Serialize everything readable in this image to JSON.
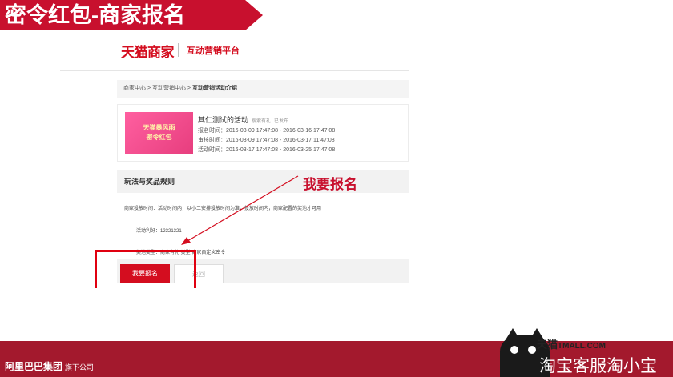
{
  "slide_title": "密令红包-商家报名",
  "header": {
    "brand": "天猫商家",
    "platform": "互动营销平台"
  },
  "breadcrumb": {
    "items": [
      "商家中心",
      "互动营销中心"
    ],
    "current": "互动营销活动介绍",
    "separator": " > "
  },
  "activity": {
    "thumb_line1": "天猫暴风雨",
    "thumb_line2": "密令红包",
    "title": "其仁测试的活动",
    "tag": "搜索有礼",
    "status": "已发布",
    "signup_time": "报名时间：2016-03-09 17:47:08 - 2016-03-16 17:47:08",
    "review_time": "审核时间：2016-03-09 17:47:08 - 2016-03-17 11:47:08",
    "event_time": "活动时间：2016-03-17 17:47:08 - 2016-03-25 17:47:08"
  },
  "rules": {
    "heading": "玩法与奖品规则",
    "line1": "商家投放时间：活动时间内，以小二安排投放时间为准；投放时间内，商家配置的奖池才可用",
    "line2": "活动利好：12321321",
    "line3": "奖池类型：商家有礼 类型 商家自定义密令"
  },
  "buttons": {
    "signup": "我要报名",
    "back": "返回"
  },
  "annotation": {
    "label": "我要报名"
  },
  "footer": {
    "group_logo": "阿里巴巴集团",
    "group_sub": "旗下公司",
    "tmall_cn": "天猫",
    "tmall_en": "TMALL.COM",
    "service": "淘宝客服淘小宝"
  },
  "colors": {
    "brand_red": "#d40d1f",
    "banner_red": "#c8102e",
    "footer_red": "#a3192d"
  }
}
